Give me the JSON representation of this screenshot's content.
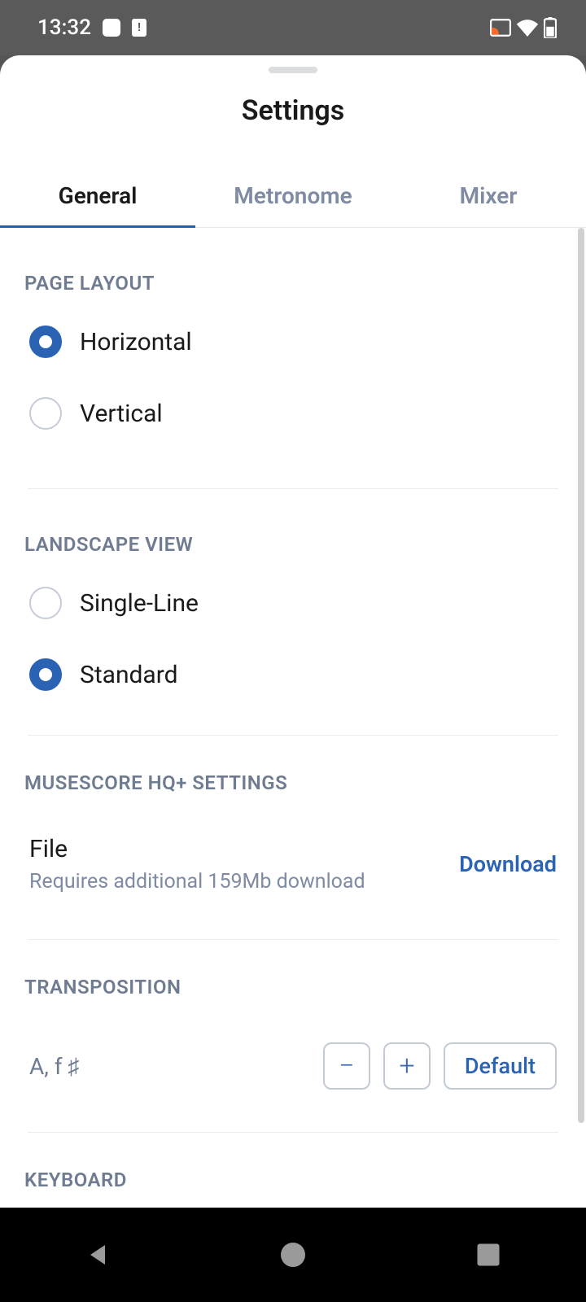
{
  "status": {
    "time": "13:32"
  },
  "header": {
    "title": "Settings"
  },
  "tabs": [
    {
      "label": "General",
      "active": true
    },
    {
      "label": "Metronome",
      "active": false
    },
    {
      "label": "Mixer",
      "active": false
    }
  ],
  "sections": {
    "page_layout": {
      "title": "PAGE LAYOUT",
      "options": [
        {
          "label": "Horizontal",
          "checked": true
        },
        {
          "label": "Vertical",
          "checked": false
        }
      ]
    },
    "landscape_view": {
      "title": "LANDSCAPE VIEW",
      "options": [
        {
          "label": "Single-Line",
          "checked": false
        },
        {
          "label": "Standard",
          "checked": true
        }
      ]
    },
    "hq": {
      "title": "MUSESCORE HQ+ SETTINGS",
      "item_title": "File",
      "item_sub": "Requires additional 159Mb download",
      "action": "Download"
    },
    "transposition": {
      "title": "TRANSPOSITION",
      "value": "A, f ♯",
      "default_label": "Default"
    },
    "keyboard": {
      "title": "KEYBOARD"
    }
  }
}
